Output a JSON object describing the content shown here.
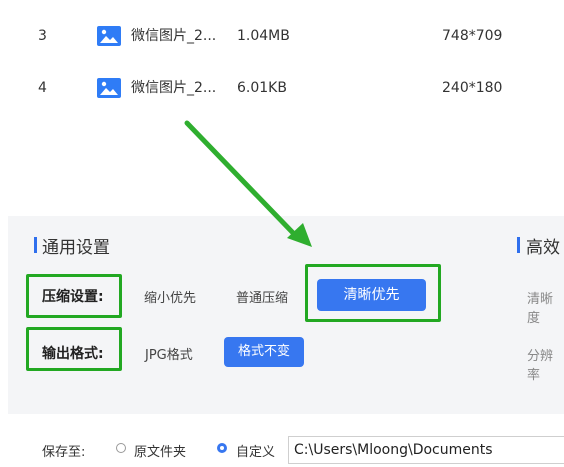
{
  "files": [
    {
      "index": "3",
      "name": "微信图片_2...",
      "size": "1.04MB",
      "resolution": "748*709"
    },
    {
      "index": "4",
      "name": "微信图片_2...",
      "size": "6.01KB",
      "resolution": "240*180"
    }
  ],
  "general": {
    "title": "通用设置",
    "compress_label": "压缩设置:",
    "compress_options": [
      "缩小优先",
      "普通压缩",
      "清晰优先"
    ],
    "output_label": "输出格式:",
    "output_options": [
      "JPG格式",
      "格式不变"
    ]
  },
  "advanced": {
    "title": "高效",
    "row1": "清晰度",
    "row2": "分辨率"
  },
  "footer": {
    "save_to_label": "保存至:",
    "option_original": "原文件夹",
    "option_custom": "自定义",
    "path": "C:\\Users\\Mloong\\Documents"
  },
  "colors": {
    "accent": "#3777f0",
    "annotation": "#22a822",
    "panel_bg": "#f4f5f7"
  }
}
